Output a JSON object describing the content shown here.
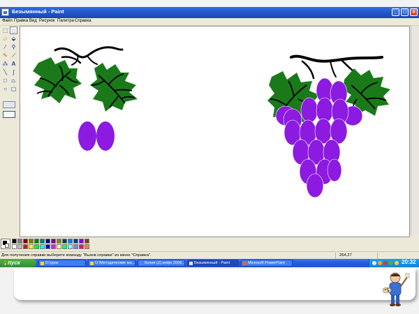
{
  "window": {
    "title": "Безымянный - Paint",
    "controls": [
      "_",
      "□",
      "×"
    ]
  },
  "menu": [
    "Файл",
    "Правка",
    "Вид",
    "Рисунок",
    "Палитра",
    "Справка"
  ],
  "tools": [
    "select-free-icon",
    "select-rect-icon",
    "eraser-icon",
    "fill-icon",
    "picker-icon",
    "magnifier-icon",
    "pencil-icon",
    "brush-icon",
    "airbrush-icon",
    "text-icon",
    "line-icon",
    "curve-icon",
    "rectangle-icon",
    "polygon-icon",
    "ellipse-icon",
    "rounded-rect-icon"
  ],
  "palette": {
    "foreground": "#000000",
    "background": "#ffffff",
    "colors": [
      "#000000",
      "#808080",
      "#800000",
      "#808000",
      "#008000",
      "#008080",
      "#000080",
      "#800080",
      "#808040",
      "#004040",
      "#0080ff",
      "#004080",
      "#8000ff",
      "#804000",
      "#ffffff",
      "#c0c0c0",
      "#ff0000",
      "#ffff00",
      "#00ff00",
      "#00ffff",
      "#0000ff",
      "#ff00ff",
      "#ffff80",
      "#00ff80",
      "#80ffff",
      "#8080ff",
      "#ff0080",
      "#ff8040"
    ]
  },
  "drawing": {
    "leaf_color": "#1a7a1a",
    "grape_color": "#8c1ae0",
    "vein_color": "#000000"
  },
  "status": {
    "help_text": "Для получения справки выберите команду \"Вызов справки\" из меню \"Справка\".",
    "coords": "264,27"
  },
  "taskbar": {
    "start_label": "пуск",
    "tasks": [
      "D:\\урок",
      "D:\\Методические ма...",
      "Копия (2) инфо 2006...",
      "Безымянный - Paint",
      "Microsoft PowerPoint"
    ],
    "clock": "20:32"
  }
}
